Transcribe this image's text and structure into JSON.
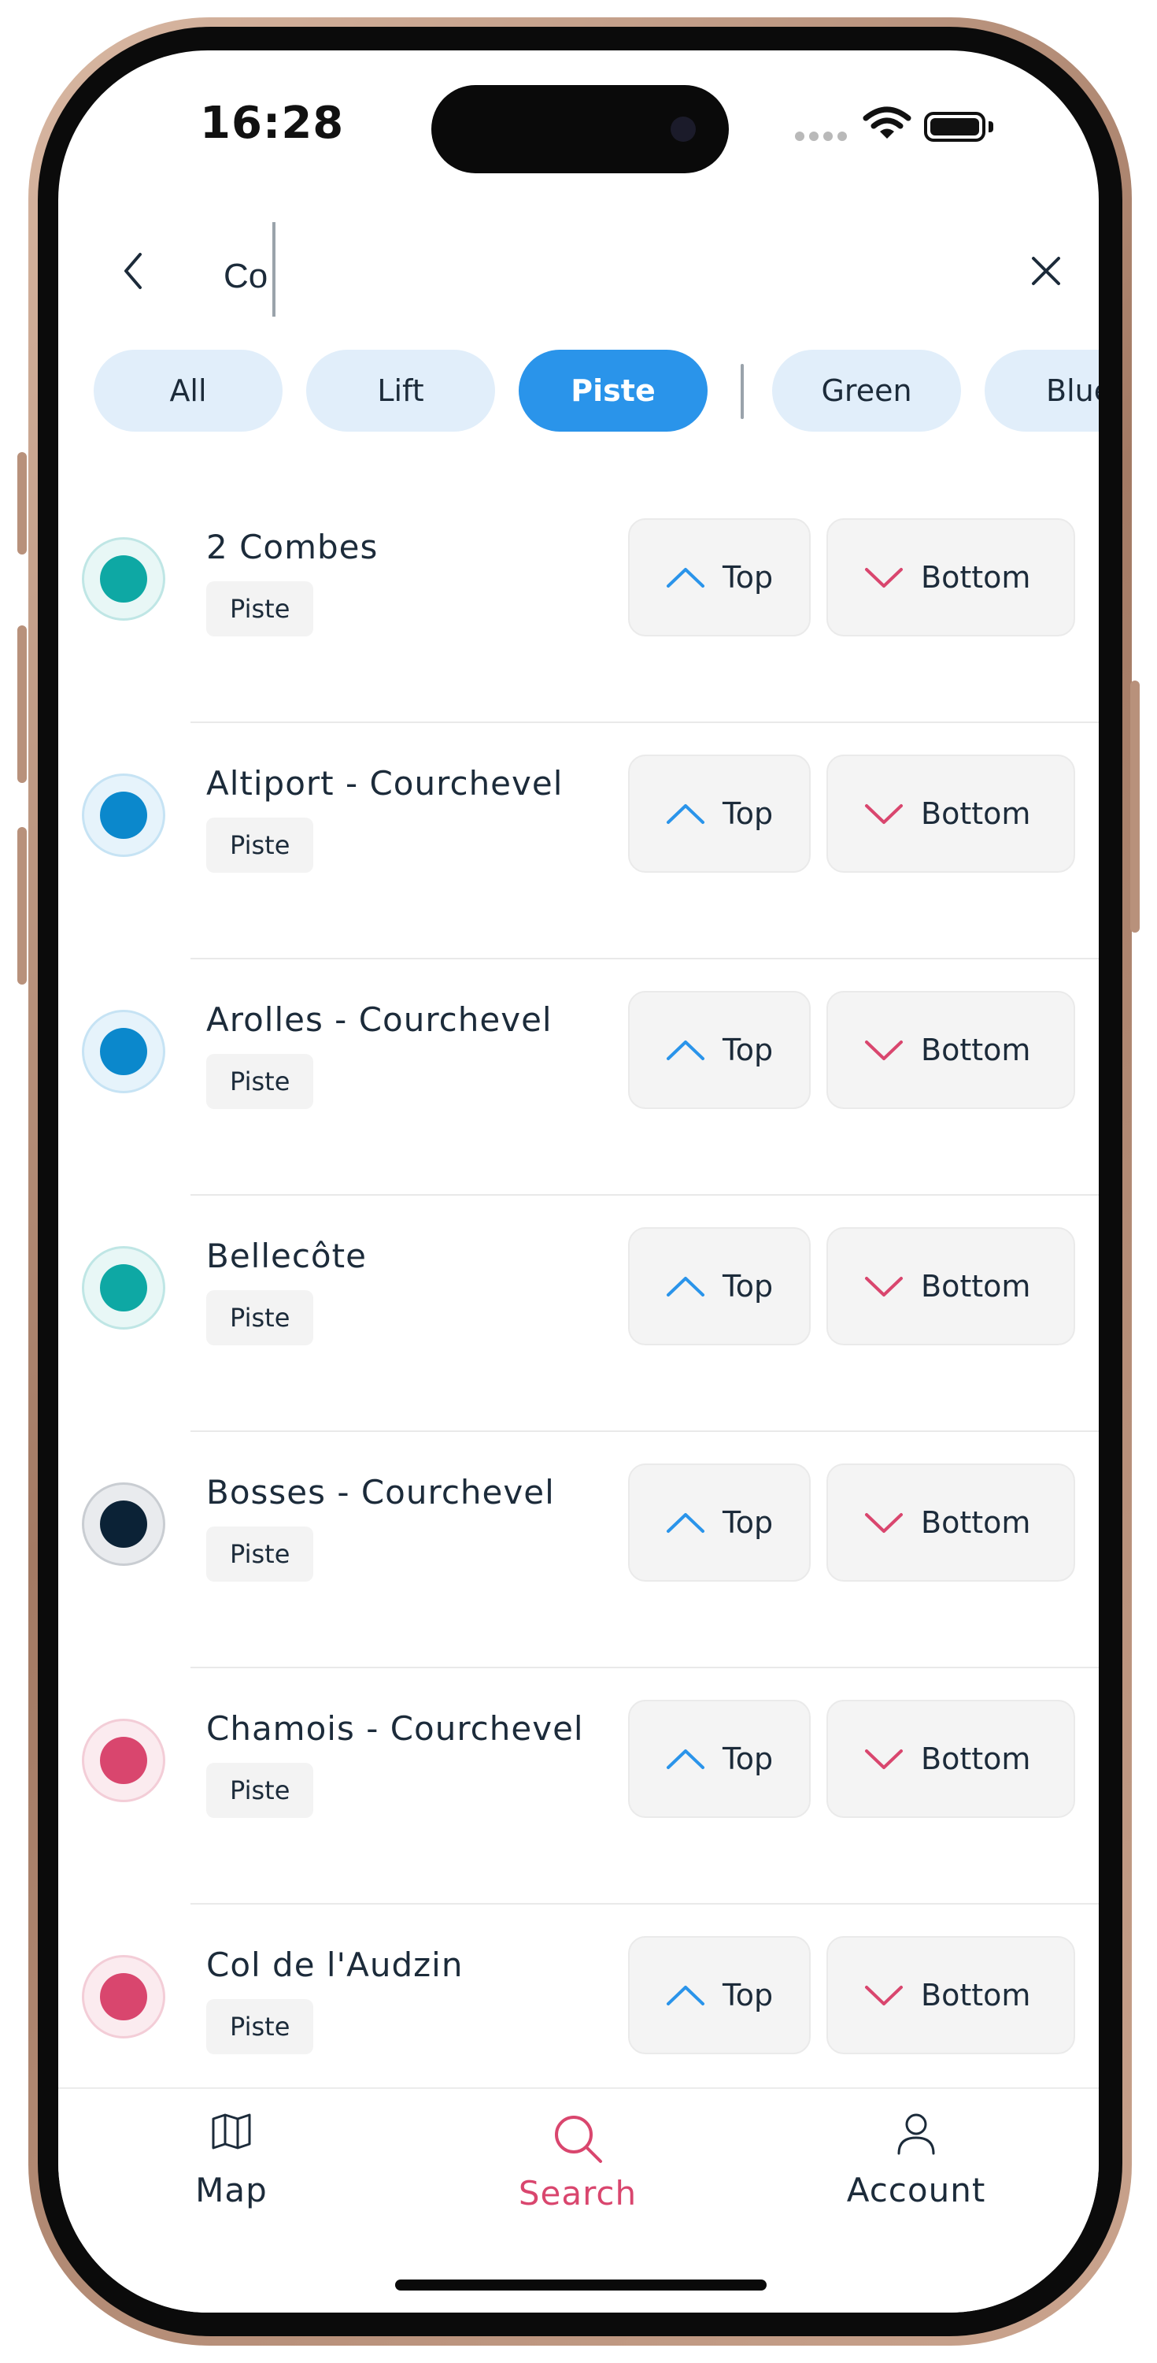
{
  "status_bar": {
    "time": "16:28"
  },
  "search": {
    "value": "Co",
    "placeholder": ""
  },
  "filters": {
    "chips": [
      {
        "label": "All",
        "active": false
      },
      {
        "label": "Lift",
        "active": false
      },
      {
        "label": "Piste",
        "active": true
      },
      {
        "label": "Green",
        "active": false
      },
      {
        "label": "Blue",
        "active": false
      }
    ]
  },
  "colors": {
    "accent_blue": "#2a94ea",
    "accent_pink": "#d9466e",
    "text": "#1c2b3a",
    "teal": "#0ea8a4",
    "blue": "#0b88cc",
    "black": "#0b2236",
    "red": "#d9466e"
  },
  "results": [
    {
      "name": "2 Combes",
      "type": "Piste",
      "difficulty": "green",
      "top_label": "Top",
      "bottom_label": "Bottom"
    },
    {
      "name": "Altiport - Courchevel",
      "type": "Piste",
      "difficulty": "blue",
      "top_label": "Top",
      "bottom_label": "Bottom"
    },
    {
      "name": "Arolles - Courchevel",
      "type": "Piste",
      "difficulty": "blue",
      "top_label": "Top",
      "bottom_label": "Bottom"
    },
    {
      "name": "Bellecôte",
      "type": "Piste",
      "difficulty": "green",
      "top_label": "Top",
      "bottom_label": "Bottom"
    },
    {
      "name": "Bosses - Courchevel",
      "type": "Piste",
      "difficulty": "black",
      "top_label": "Top",
      "bottom_label": "Bottom"
    },
    {
      "name": "Chamois - Courchevel",
      "type": "Piste",
      "difficulty": "red",
      "top_label": "Top",
      "bottom_label": "Bottom"
    },
    {
      "name": "Col de l'Audzin",
      "type": "Piste",
      "difficulty": "red",
      "top_label": "Top",
      "bottom_label": "Bottom"
    }
  ],
  "tabbar": {
    "items": [
      {
        "label": "Map",
        "icon": "map-icon",
        "active": false
      },
      {
        "label": "Search",
        "icon": "search-icon",
        "active": true
      },
      {
        "label": "Account",
        "icon": "account-icon",
        "active": false
      }
    ]
  }
}
